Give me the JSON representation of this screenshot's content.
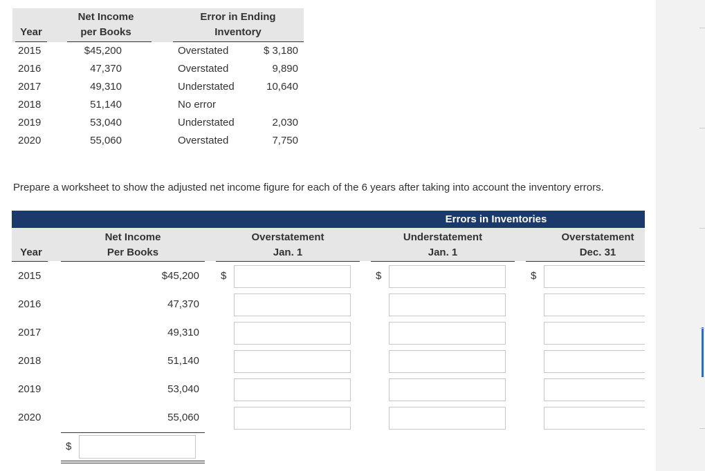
{
  "top_table": {
    "headers": {
      "year": "Year",
      "net_income_l1": "Net Income",
      "net_income_l2": "per Books",
      "error_l1": "Error in Ending",
      "error_l2": "Inventory"
    },
    "rows": [
      {
        "year": "2015",
        "net_income": "$45,200",
        "status": "Overstated",
        "amount": "$ 3,180"
      },
      {
        "year": "2016",
        "net_income": "47,370",
        "status": "Overstated",
        "amount": "9,890"
      },
      {
        "year": "2017",
        "net_income": "49,310",
        "status": "Understated",
        "amount": "10,640"
      },
      {
        "year": "2018",
        "net_income": "51,140",
        "status": "No error",
        "amount": ""
      },
      {
        "year": "2019",
        "net_income": "53,040",
        "status": "Understated",
        "amount": "2,030"
      },
      {
        "year": "2020",
        "net_income": "55,060",
        "status": "Overstated",
        "amount": "7,750"
      }
    ]
  },
  "instruction": "Prepare a worksheet to show the adjusted net income figure for each of the 6 years after taking into account the inventory errors.",
  "worksheet": {
    "banner": "Errors in Inventories",
    "headers": {
      "year": "Year",
      "ni_l1": "Net Income",
      "ni_l2": "Per Books",
      "over_jan_l1": "Overstatement",
      "over_jan_l2": "Jan. 1",
      "under_jan_l1": "Understatement",
      "under_jan_l2": "Jan. 1",
      "over_dec_l1": "Overstatement",
      "over_dec_l2": "Dec. 31"
    },
    "dollar": "$",
    "rows": [
      {
        "year": "2015",
        "ni": "$45,200"
      },
      {
        "year": "2016",
        "ni": "47,370"
      },
      {
        "year": "2017",
        "ni": "49,310"
      },
      {
        "year": "2018",
        "ni": "51,140"
      },
      {
        "year": "2019",
        "ni": "53,040"
      },
      {
        "year": "2020",
        "ni": "55,060"
      }
    ]
  }
}
